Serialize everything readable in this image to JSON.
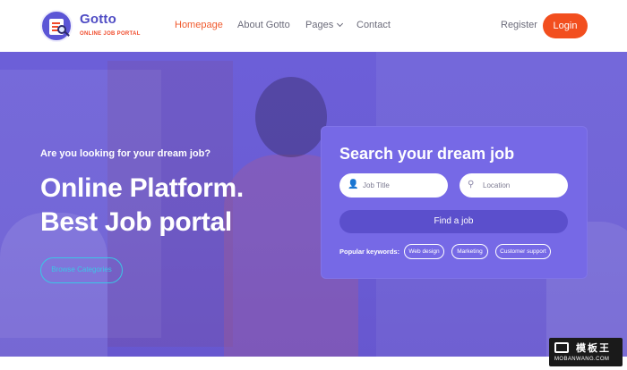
{
  "header": {
    "brand": {
      "name": "Gotto",
      "tagline": "ONLINE JOB PORTAL"
    },
    "nav": [
      {
        "label": "Homepage",
        "active": true
      },
      {
        "label": "About Gotto",
        "active": false
      },
      {
        "label": "Pages",
        "active": false,
        "has_dropdown": true
      },
      {
        "label": "Contact",
        "active": false
      }
    ],
    "register_label": "Register",
    "login_label": "Login"
  },
  "hero": {
    "subtitle": "Are you looking for your dream job?",
    "title_line1": "Online Platform.",
    "title_line2": "Best Job portal",
    "browse_label": "Browse Categories"
  },
  "search": {
    "title": "Search your dream job",
    "job_placeholder": "Job Title",
    "location_placeholder": "Location",
    "find_label": "Find a job",
    "popular_label": "Popular keywords:",
    "keywords": [
      "Web design",
      "Marketing",
      "Customer support"
    ]
  },
  "watermark": {
    "cn": "模板王",
    "en": "MOBANWANG.COM"
  },
  "colors": {
    "brand": "#4f4cc4",
    "accent": "#f24e1e",
    "hero_overlay": "#6c5fd8",
    "panel": "#7669e6",
    "outline_button": "#3bc6e6"
  },
  "icons": {
    "job_field": "user-icon",
    "location_field": "map-pin-icon",
    "pages_dropdown": "chevron-down-icon"
  }
}
